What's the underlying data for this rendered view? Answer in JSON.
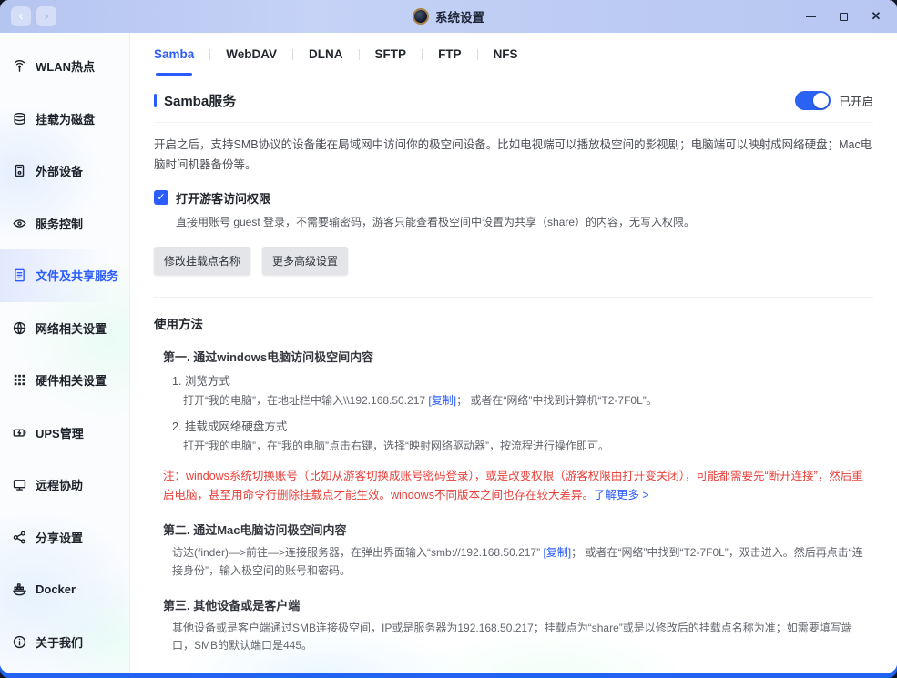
{
  "window": {
    "title": "系统设置"
  },
  "titlebar": {
    "back": "‹",
    "forward": "›",
    "close": "✕"
  },
  "sidebar": {
    "items": [
      {
        "label": "WLAN热点",
        "icon": "wifi-hotspot-icon",
        "selected": false
      },
      {
        "label": "挂载为磁盘",
        "icon": "mount-disk-icon",
        "selected": false
      },
      {
        "label": "外部设备",
        "icon": "external-device-icon",
        "selected": false
      },
      {
        "label": "服务控制",
        "icon": "service-control-icon",
        "selected": false
      },
      {
        "label": "文件及共享服务",
        "icon": "file-share-icon",
        "selected": true
      },
      {
        "label": "网络相关设置",
        "icon": "network-settings-icon",
        "selected": false
      },
      {
        "label": "硬件相关设置",
        "icon": "hardware-settings-icon",
        "selected": false
      },
      {
        "label": "UPS管理",
        "icon": "ups-battery-icon",
        "selected": false
      },
      {
        "label": "远程协助",
        "icon": "remote-assist-icon",
        "selected": false
      },
      {
        "label": "分享设置",
        "icon": "share-settings-icon",
        "selected": false
      },
      {
        "label": "Docker",
        "icon": "docker-icon",
        "selected": false
      },
      {
        "label": "关于我们",
        "icon": "about-info-icon",
        "selected": false
      }
    ]
  },
  "tabs": {
    "active": "Samba",
    "items": [
      "Samba",
      "WebDAV",
      "DLNA",
      "SFTP",
      "FTP",
      "NFS"
    ]
  },
  "samba": {
    "section_title": "Samba服务",
    "toggle_label": "已开启",
    "toggle_on": true,
    "description": "开启之后，支持SMB协议的设备能在局域网中访问你的极空间设备。比如电视端可以播放极空间的影视剧；电脑端可以映射成网络硬盘；Mac电脑时间机器备份等。",
    "guest_label": "打开游客访问权限",
    "guest_checked": true,
    "guest_description": "直接用账号 guest 登录，不需要输密码，游客只能查看极空间中设置为共享（share）的内容，无写入权限。",
    "modify_button": "修改挂载点名称",
    "advanced_button": "更多高级设置"
  },
  "usage": {
    "title": "使用方法",
    "windows": {
      "heading": "第一. 通过windows电脑访问极空间内容",
      "item1_title": "1. 浏览方式",
      "item1_pre": "打开“我的电脑”，在地址栏中输入\\\\192.168.50.217 ",
      "copy_label": "[复制]",
      "item1_post": "； 或者在“网络”中找到计算机“T2-7F0L”。",
      "item2_title": "2. 挂载成网络硬盘方式",
      "item2_text": "打开“我的电脑”，在“我的电脑”点击右键，选择“映射网络驱动器”，按流程进行操作即可。",
      "note": "注：windows系统切换账号（比如从游客切换成账号密码登录），或是改变权限（游客权限由打开变关闭），可能都需要先“断开连接”，然后重启电脑，甚至用命令行删除挂载点才能生效。windows不同版本之间也存在较大差异。",
      "learn_more": "了解更多 >"
    },
    "mac": {
      "heading": "第二. 通过Mac电脑访问极空间内容",
      "text_pre": "访达(finder)—>前往—>连接服务器，在弹出界面输入“smb://192.168.50.217”  ",
      "copy_label": "[复制]",
      "text_post": "； 或者在“网络”中找到“T2-7F0L”，双击进入。然后再点击“连接身份”，输入极空间的账号和密码。"
    },
    "other": {
      "heading": "第三. 其他设备或是客户端",
      "text": "其他设备或是客户端通过SMB连接极空间，IP或是服务器为192.168.50.217；挂载点为“share”或是以修改后的挂载点名称为准；如需要填写端口，SMB的默认端口是445。"
    }
  },
  "colors": {
    "accent": "#2b5cff",
    "danger_text": "#e8403a",
    "titlebar": "#bccbf3",
    "toggle_on": "#2a62f2",
    "bottom_strip": "#2264f1"
  }
}
